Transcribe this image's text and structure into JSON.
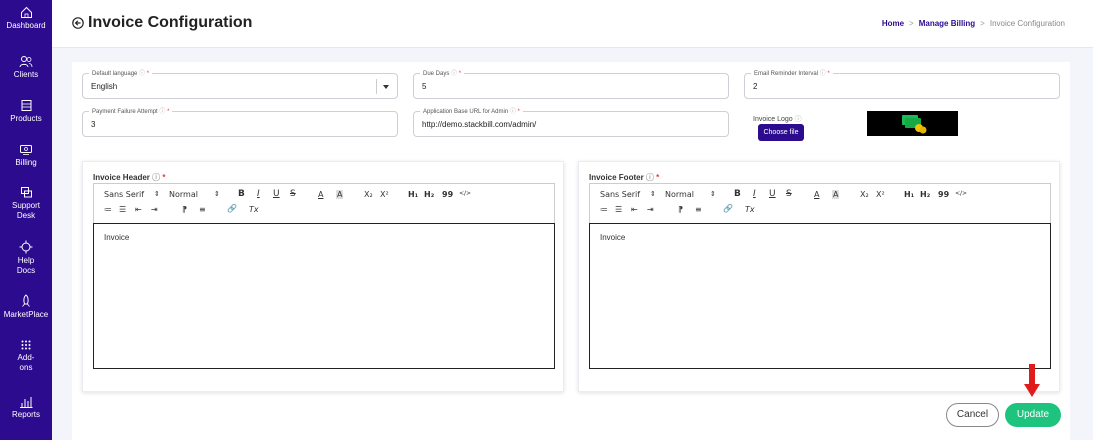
{
  "sidebar": {
    "items": [
      {
        "label": "Dashboard"
      },
      {
        "label": "Clients"
      },
      {
        "label": "Products"
      },
      {
        "label": "Billing"
      },
      {
        "label_line1": "Support",
        "label_line2": "Desk"
      },
      {
        "label_line1": "Help",
        "label_line2": "Docs"
      },
      {
        "label": "MarketPlace"
      },
      {
        "label_line1": "Add-",
        "label_line2": "ons"
      },
      {
        "label": "Reports"
      }
    ]
  },
  "header": {
    "title": "Invoice Configuration",
    "breadcrumb": [
      "Home",
      "Manage Billing",
      "Invoice Configuration"
    ],
    "separator": ">"
  },
  "form": {
    "default_language": {
      "label": "Default language",
      "value": "English"
    },
    "due_days": {
      "label": "Due Days",
      "value": "5"
    },
    "email_reminder_interval": {
      "label": "Email Reminder Interval",
      "value": "2"
    },
    "payment_failure_attempt": {
      "label": "Payment Failure Attempt",
      "value": "3"
    },
    "app_base_url": {
      "label": "Application Base URL for Admin",
      "value": "http://demo.stackbill.com/admin/"
    },
    "invoice_logo": {
      "label": "Invoice Logo",
      "button": "Choose file"
    },
    "help_glyph": "ⓘ",
    "required_mark": "*"
  },
  "editors": {
    "header": {
      "title": "Invoice Header",
      "content": "Invoice"
    },
    "footer": {
      "title": "Invoice Footer",
      "content": "Invoice"
    },
    "toolbar": {
      "font": "Sans Serif",
      "size": "Normal",
      "updown": "⇕",
      "bold": "B",
      "italic": "I",
      "underline": "U",
      "strike": "S",
      "color": "A",
      "background": "A",
      "subscript": "X₂",
      "superscript": "X²",
      "h1": "H₁",
      "h2": "H₂",
      "quote": "99",
      "code": "</>",
      "ordered_list": "≔",
      "bullet_list": "☰",
      "outdent": "⇤",
      "indent": "⇥",
      "direction": "⁋",
      "align": "≡",
      "link": "🔗",
      "clean": "Tx"
    }
  },
  "actions": {
    "cancel": "Cancel",
    "update": "Update"
  },
  "colors": {
    "sidebar": "#2c0b8e",
    "accent": "#2c0b8e",
    "update": "#1ec47e",
    "arrow": "#e01b1b",
    "logo_coins": "#1db954"
  }
}
